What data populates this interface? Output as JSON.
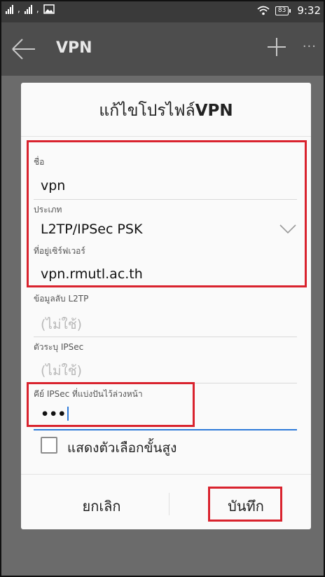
{
  "statusbar": {
    "time": "9:32",
    "battery_level": "83",
    "icons": [
      "signal-icon",
      "signal-icon",
      "image-icon",
      "wifi-icon",
      "battery-icon"
    ]
  },
  "appbar": {
    "title": "VPN",
    "icons": [
      "back-arrow-icon",
      "plus-icon",
      "more-icon"
    ]
  },
  "dialog": {
    "title_thai": "แก้ไขโปรไฟล์",
    "title_vpn": "VPN",
    "fields": {
      "name": {
        "label": "ชื่อ",
        "value": "vpn"
      },
      "type": {
        "label": "ประเภท",
        "value": "L2TP/IPSec PSK"
      },
      "server": {
        "label": "ที่อยู่เซิร์ฟเวอร์",
        "value": "vpn.rmutl.ac.th"
      },
      "l2tp_secret": {
        "label": "ข้อมูลลับ L2TP",
        "value": "(ไม่ใช้)"
      },
      "ipsec_id": {
        "label": "ตัวระบุ IPSec",
        "value": "(ไม่ใช้)"
      },
      "ipsec_psk": {
        "label": "คีย์ IPSec ที่แบ่งปันไว้ล่วงหน้า",
        "value": "•••"
      }
    },
    "advanced_checkbox": {
      "label": "แสดงตัวเลือกขั้นสูง",
      "checked": false
    },
    "buttons": {
      "cancel": "ยกเลิก",
      "save": "บันทึก"
    }
  },
  "colors": {
    "highlight": "#d9232e",
    "accent": "#2f7bd9",
    "overlay": "#6b6b6b"
  }
}
